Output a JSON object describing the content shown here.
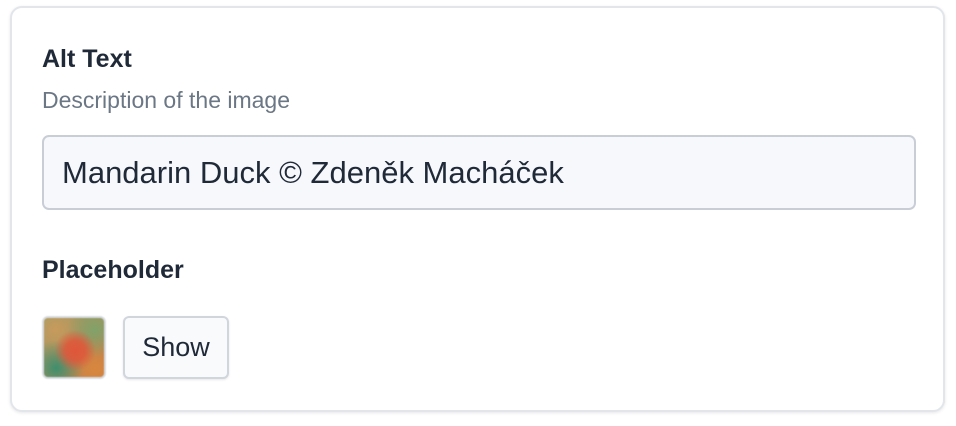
{
  "alt_text": {
    "label": "Alt Text",
    "description": "Description of the image",
    "value": "Mandarin Duck © Zdeněk Macháček"
  },
  "placeholder": {
    "label": "Placeholder",
    "show_button_label": "Show",
    "thumbnail_icon": "blurred-image-thumbnail"
  },
  "colors": {
    "label_text": "#1f2937",
    "description_text": "#6b7785",
    "input_background": "#f6f8fb",
    "border": "#c9ced6"
  }
}
